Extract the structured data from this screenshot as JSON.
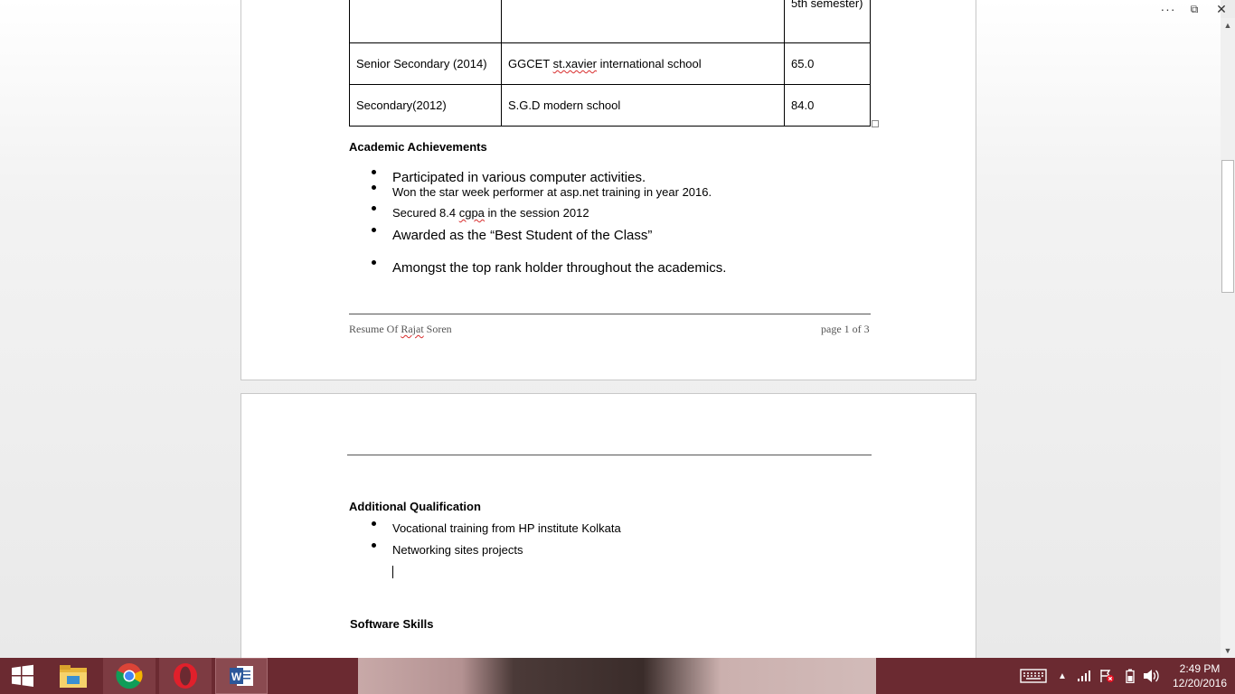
{
  "window_controls": {
    "more": "···",
    "restore": "⧉",
    "close": "✕"
  },
  "education_table": {
    "rows": [
      [
        "",
        "",
        "5th semester)"
      ],
      [
        "Senior Secondary (2014)",
        "GGCET st.xavier international school",
        "65.0"
      ],
      [
        "Secondary(2012)",
        "S.G.D modern school",
        "84.0"
      ]
    ]
  },
  "academic": {
    "heading": "Academic Achievements",
    "items": [
      "Participated in various computer activities.",
      "Won the star week performer at asp.net training in year 2016.",
      "Secured 8.4 cgpa in the session 2012",
      "Awarded as the “Best Student of the Class”",
      "Amongst the top rank holder throughout the academics."
    ]
  },
  "footer": {
    "left": "Resume Of Rajat Soren",
    "right": "page 1 of 3"
  },
  "additional": {
    "heading": "Additional Qualification",
    "items": [
      "Vocational training from HP institute Kolkata",
      "Networking sites projects"
    ]
  },
  "software": {
    "heading": "Software Skills"
  },
  "taskbar": {
    "apps": [
      {
        "name": "start-button",
        "icon": "windows-logo-icon"
      },
      {
        "name": "file-explorer",
        "icon": "folder-icon"
      },
      {
        "name": "chrome",
        "icon": "chrome-icon"
      },
      {
        "name": "opera",
        "icon": "opera-icon"
      },
      {
        "name": "word",
        "icon": "word-icon"
      }
    ],
    "clock_time": "2:49 PM",
    "clock_date": "12/20/2016"
  },
  "colors": {
    "taskbar": "#6b2a31",
    "spellcheck": "#d82c2c",
    "word_blue": "#2b579a"
  }
}
